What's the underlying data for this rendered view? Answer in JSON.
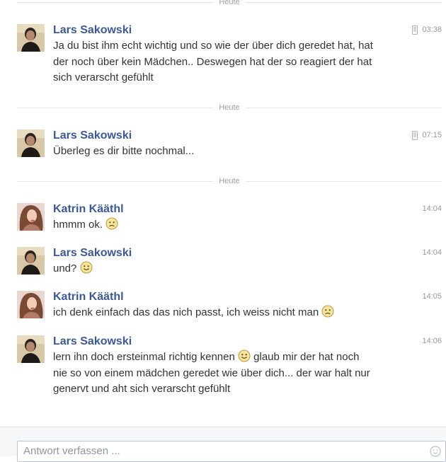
{
  "dividers": [
    "Heute",
    "Heute",
    "Heute"
  ],
  "messages": [
    {
      "sender": "Lars Sakowski",
      "time": "03:38",
      "via_mobile": true,
      "lines": [
        "Ja du bist ihm echt wichtig und so wie der über dich geredet hat, hat",
        "der noch über kein Mädchen.. Deswegen hat der so reagiert der hat",
        "sich verarscht gefühlt"
      ]
    },
    {
      "sender": "Lars Sakowski",
      "time": "07:15",
      "via_mobile": true,
      "lines": [
        "Überleg es dir bitte nochmal..."
      ]
    },
    {
      "sender": "Katrin Kääthl",
      "time": "14:04",
      "via_mobile": false,
      "lines": [
        "hmmm ok."
      ],
      "emoticon": "frown"
    },
    {
      "sender": "Lars Sakowski",
      "time": "14:04",
      "via_mobile": false,
      "lines": [
        "und?"
      ],
      "emoticon": "smile"
    },
    {
      "sender": "Katrin Kääthl",
      "time": "14:05",
      "via_mobile": false,
      "lines": [
        "ich denk einfach das das nich passt, ich weiss nicht man"
      ],
      "emoticon": "frown"
    },
    {
      "sender": "Lars Sakowski",
      "time": "14:06",
      "via_mobile": false,
      "line1_before": "lern ihn doch ersteinmal richtig kennen",
      "line1_after": "glaub mir der hat noch",
      "lines": [
        "nie so von einem mädchen geredet wie über dich... der war halt nur",
        "genervt und aht sich verarscht gefühlt"
      ],
      "emoticon": "smile"
    }
  ],
  "composer": {
    "placeholder": "Antwort verfassen ..."
  },
  "colors": {
    "name_blue": "#3b5998",
    "text": "#333333",
    "meta_gray": "#999999",
    "divider": "#e5e5e5"
  },
  "icons": [
    "mobile-phone-icon",
    "frown-emoticon-icon",
    "smile-emoticon-icon",
    "emoji-picker-icon"
  ]
}
